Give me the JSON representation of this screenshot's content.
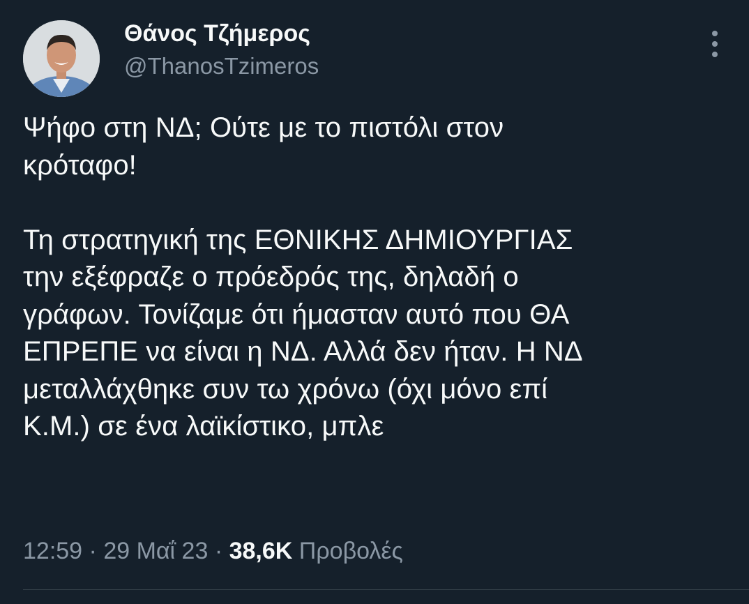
{
  "author": {
    "display_name": "Θάνος Τζήμερος",
    "handle": "@ThanosTzimeros"
  },
  "tweet": {
    "text": "Ψήφο στη ΝΔ; Ούτε με το πιστόλι στον\nκρόταφο!\n\nΤη στρατηγική της ΕΘΝΙΚΗΣ ΔΗΜΙΟΥΡΓΙΑΣ\nτην εξέφραζε ο πρόεδρός της, δηλαδή ο\nγράφων. Τονίζαμε ότι ήμασταν αυτό που ΘΑ\nΕΠΡΕΠΕ να είναι η ΝΔ. Αλλά δεν ήταν. Η ΝΔ\nμεταλλάχθηκε συν τω χρόνω (όχι μόνο επί\nΚ.Μ.) σε ένα λαϊκίστικο, μπλε"
  },
  "meta": {
    "time": "12:59",
    "separator": " · ",
    "date": "29 Μαΐ 23",
    "views_count": "38,6K",
    "views_label": "Προβολές"
  },
  "icons": {
    "more": "more-vertical-icon",
    "avatar": "profile-photo"
  },
  "colors": {
    "background": "#15202b",
    "primary_text": "#f7f9f9",
    "secondary_text": "#8b98a5",
    "divider": "#38444d"
  }
}
